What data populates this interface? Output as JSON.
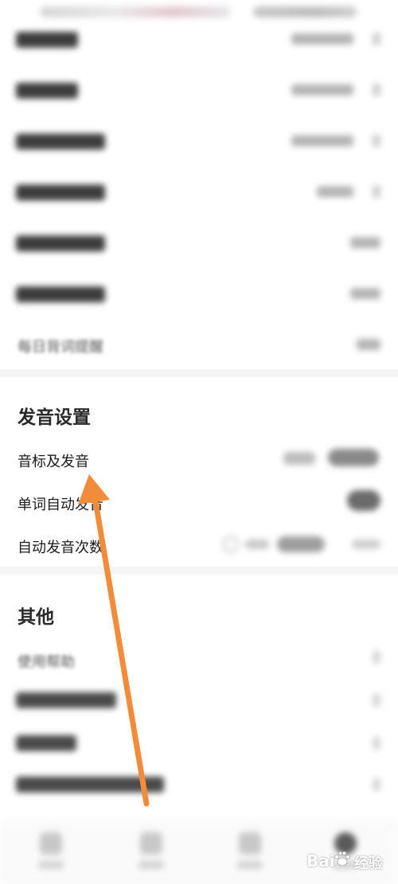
{
  "settings": {
    "last_row_label": "每日背词提醒"
  },
  "pronunciation": {
    "section_title": "发音设置",
    "phonetic_label": "音标及发音",
    "auto_pronounce_label": "单词自动发音",
    "auto_times_label": "自动发音次数"
  },
  "other": {
    "section_title": "其他",
    "help_label": "使用帮助"
  },
  "watermark": {
    "brand": "Bai",
    "brand_cn": "经验"
  },
  "annotation": {
    "arrow_color": "#f28c3a"
  },
  "colors": {
    "section_bg": "#f5f5f5",
    "text_primary": "#1c1c1c"
  }
}
